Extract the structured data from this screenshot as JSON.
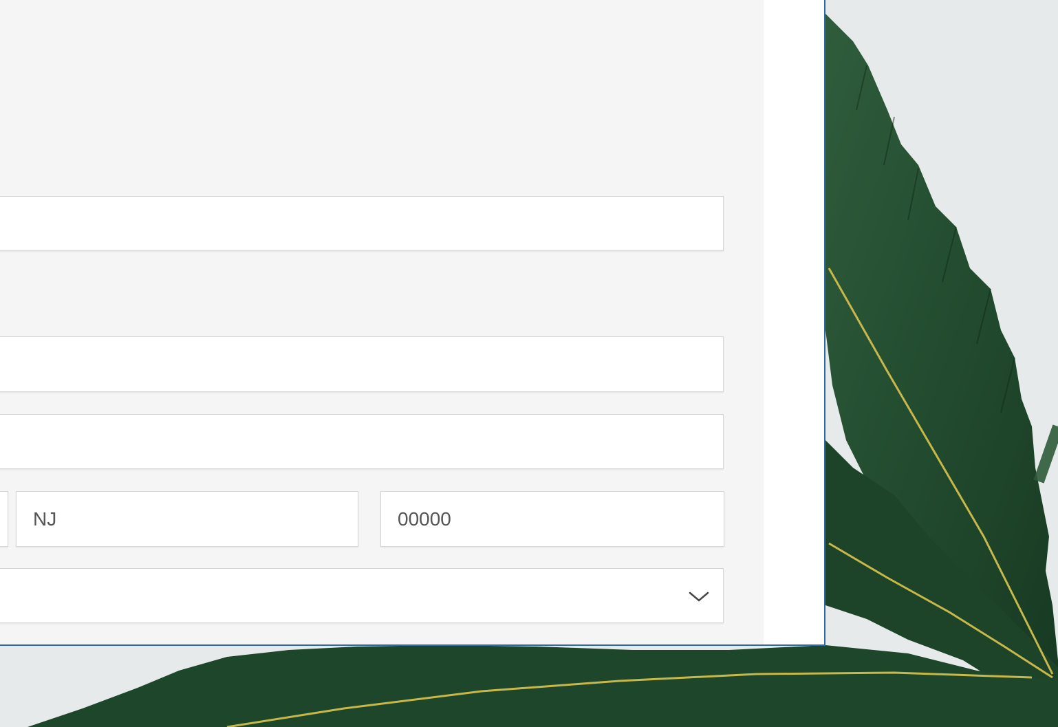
{
  "form": {
    "state_value": "NJ",
    "zip_value": "00000",
    "field_blank_1": "",
    "field_blank_2": "",
    "field_blank_3": "",
    "select_value": ""
  },
  "icons": {
    "select_chevron": "chevron-down-icon"
  },
  "colors": {
    "panel_border": "#2e6aa8",
    "panel_background": "#f5f5f5",
    "leaf_dark": "#1f4a2c",
    "leaf_vein": "#c8b84a"
  }
}
